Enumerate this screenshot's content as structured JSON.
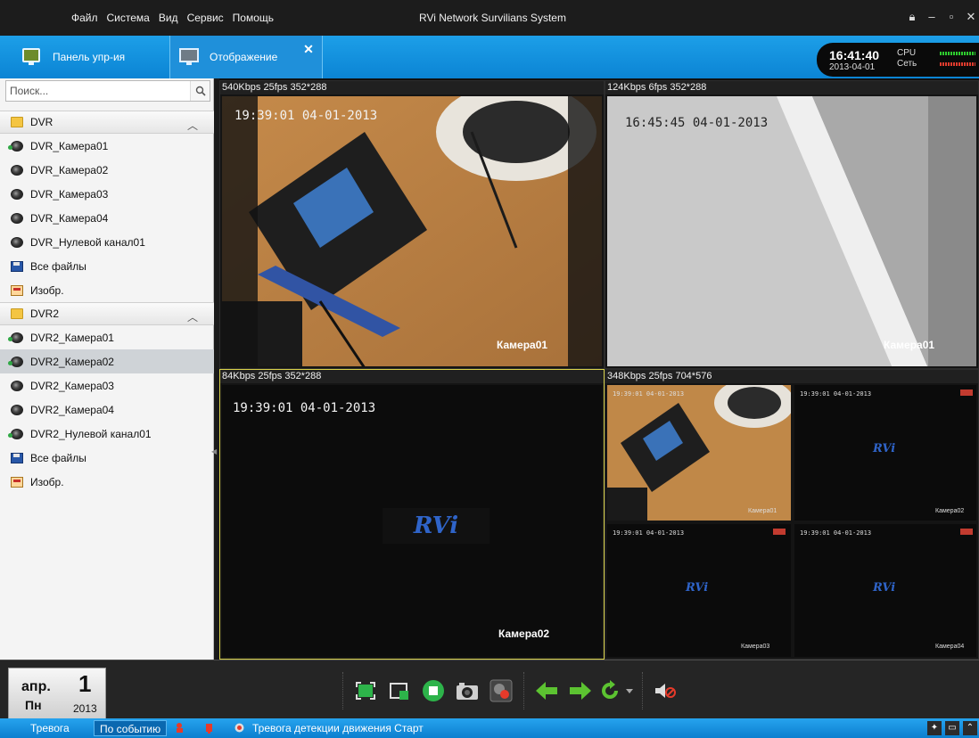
{
  "menu": {
    "items": [
      "Файл",
      "Система",
      "Вид",
      "Сервис",
      "Помощь"
    ]
  },
  "app_title": "RVi Network Survilians System",
  "tabs": [
    {
      "label": "Панель упр-ия",
      "icon": "control-panel-icon"
    },
    {
      "label": "Отображение",
      "icon": "display-icon",
      "active": true
    }
  ],
  "clock": {
    "time": "16:41:40",
    "date": "2013-04-01",
    "cpu_label": "CPU",
    "net_label": "Сеть"
  },
  "search": {
    "placeholder": "Поиск..."
  },
  "sidebar": {
    "groups": [
      {
        "label": "DVR",
        "items": [
          {
            "label": "DVR_Камера01",
            "icon": "camera-live-icon"
          },
          {
            "label": "DVR_Камера02",
            "icon": "camera-icon"
          },
          {
            "label": "DVR_Камера03",
            "icon": "camera-icon"
          },
          {
            "label": "DVR_Камера04",
            "icon": "camera-icon"
          },
          {
            "label": "DVR_Нулевой канал01",
            "icon": "camera-icon"
          },
          {
            "label": "Все файлы",
            "icon": "save-icon"
          },
          {
            "label": "Изобр.",
            "icon": "image-icon"
          }
        ]
      },
      {
        "label": "DVR2",
        "items": [
          {
            "label": "DVR2_Камера01",
            "icon": "camera-live-icon"
          },
          {
            "label": "DVR2_Камера02",
            "icon": "camera-live-icon",
            "selected": true
          },
          {
            "label": "DVR2_Камера03",
            "icon": "camera-icon"
          },
          {
            "label": "DVR2_Камера04",
            "icon": "camera-icon"
          },
          {
            "label": "DVR2_Нулевой канал01",
            "icon": "camera-live-icon"
          },
          {
            "label": "Все файлы",
            "icon": "save-icon"
          },
          {
            "label": "Изобр.",
            "icon": "image-icon"
          }
        ]
      }
    ]
  },
  "views": [
    {
      "header": "540Kbps 25fps 352*288",
      "timestamp": "19:39:01 04-01-2013",
      "camera": "Камера01"
    },
    {
      "header": "124Kbps 6fps 352*288",
      "timestamp": "16:45:45 04-01-2013",
      "camera": "Камера01"
    },
    {
      "header": "84Kbps 25fps 352*288",
      "timestamp": "19:39:01 04-01-2013",
      "camera": "Камера02",
      "active": true
    },
    {
      "header": "348Kbps 25fps 704*576",
      "subviews": [
        {
          "timestamp": "19:39:01 04-01-2013",
          "camera": "Камера01"
        },
        {
          "timestamp": "19:39:01 04-01-2013",
          "camera": "Камера02"
        },
        {
          "timestamp": "19:39:01 04-01-2013",
          "camera": "Камера03"
        },
        {
          "timestamp": "19:39:01 04-01-2013",
          "camera": "Камера04"
        }
      ]
    }
  ],
  "logo": "RVi",
  "date_widget": {
    "month": "апр.",
    "day": "1",
    "weekday": "Пн",
    "year": "2013"
  },
  "toolbar": {
    "buttons": [
      "fullscreen-icon",
      "layout-icon",
      "stop-icon",
      "snapshot-icon",
      "record-icon",
      "prev-icon",
      "next-icon",
      "cycle-icon",
      "dropdown-icon",
      "mute-icon"
    ]
  },
  "statusbar": {
    "tab_alarm": "Тревога",
    "tab_event": "По событию",
    "message": "Тревога детекции движения Старт"
  },
  "colors": {
    "accent": "#1a96e2",
    "selection": "#d9d24a"
  }
}
